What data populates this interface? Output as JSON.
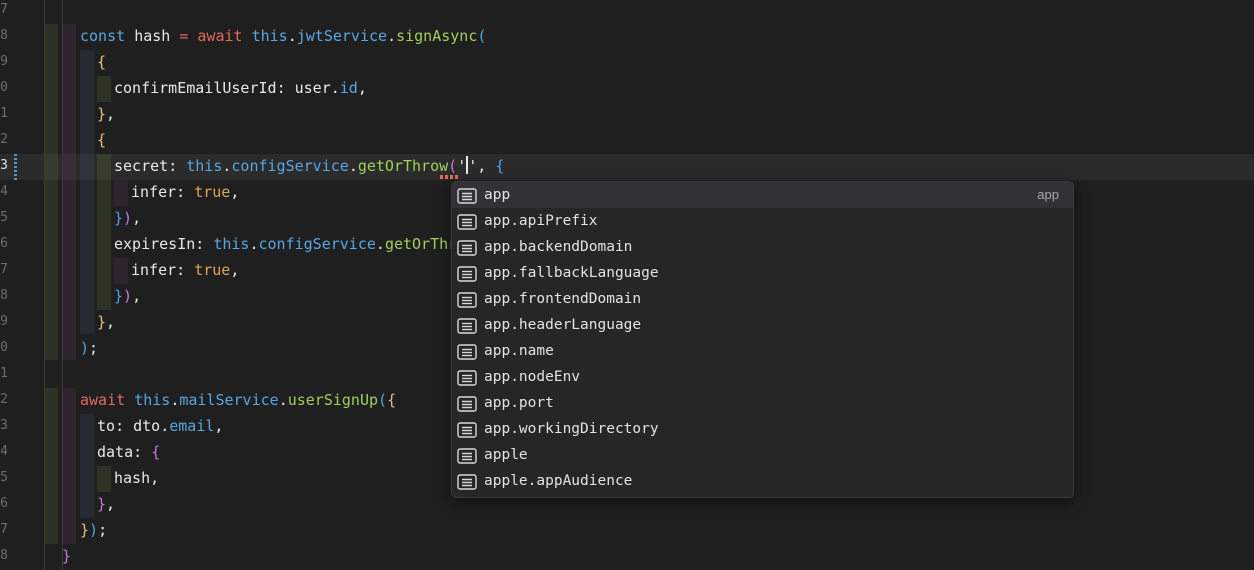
{
  "editor": {
    "gutter_numbers": [
      "7",
      "8",
      "9",
      "0",
      "1",
      "2",
      "3",
      "4",
      "5",
      "6",
      "7",
      "8",
      "9",
      "0",
      "1",
      "2",
      "3",
      "4",
      "5",
      "6",
      "7",
      "8"
    ],
    "active_line_number": "3",
    "lines": [
      {
        "tokens": []
      },
      {
        "tokens": [
          {
            "t": "const ",
            "c": "tk-kw"
          },
          {
            "t": "hash ",
            "c": "tk-var"
          },
          {
            "t": "= ",
            "c": "tk-op"
          },
          {
            "t": "await ",
            "c": "tk-kw2"
          },
          {
            "t": "this",
            "c": "tk-kw"
          },
          {
            "t": ".",
            "c": "tk-var"
          },
          {
            "t": "jwtService",
            "c": "tk-prop"
          },
          {
            "t": ".",
            "c": "tk-var"
          },
          {
            "t": "signAsync",
            "c": "tk-fn"
          },
          {
            "t": "(",
            "c": "br3"
          }
        ]
      },
      {
        "tokens": [
          {
            "t": "{",
            "c": "br1"
          }
        ]
      },
      {
        "tokens": [
          {
            "t": "confirmEmailUserId",
            "c": "tk-key"
          },
          {
            "t": ": ",
            "c": "tk-var"
          },
          {
            "t": "user",
            "c": "tk-var"
          },
          {
            "t": ".",
            "c": "tk-var"
          },
          {
            "t": "id",
            "c": "tk-prop"
          },
          {
            "t": ",",
            "c": "tk-var"
          }
        ]
      },
      {
        "tokens": [
          {
            "t": "}",
            "c": "br1"
          },
          {
            "t": ",",
            "c": "tk-var"
          }
        ]
      },
      {
        "tokens": [
          {
            "t": "{",
            "c": "br1"
          }
        ]
      },
      {
        "tokens": [
          {
            "t": "secret",
            "c": "tk-key"
          },
          {
            "t": ": ",
            "c": "tk-var"
          },
          {
            "t": "this",
            "c": "tk-kw"
          },
          {
            "t": ".",
            "c": "tk-var"
          },
          {
            "t": "configService",
            "c": "tk-prop"
          },
          {
            "t": ".",
            "c": "tk-var"
          },
          {
            "t": "getOrThrow",
            "c": "tk-fn"
          },
          {
            "t": "(",
            "c": "br2"
          },
          {
            "t": "'",
            "c": "tk-str"
          },
          {
            "t": "|CURSOR|",
            "c": "cursor"
          },
          {
            "t": "'",
            "c": "tk-str"
          },
          {
            "t": ", ",
            "c": "tk-var"
          },
          {
            "t": "{",
            "c": "br3"
          }
        ]
      },
      {
        "tokens": [
          {
            "t": "infer",
            "c": "tk-key"
          },
          {
            "t": ": ",
            "c": "tk-var"
          },
          {
            "t": "true",
            "c": "tk-bool"
          },
          {
            "t": ",",
            "c": "tk-var"
          }
        ]
      },
      {
        "tokens": [
          {
            "t": "}",
            "c": "br3"
          },
          {
            "t": ")",
            "c": "br2"
          },
          {
            "t": ",",
            "c": "tk-var"
          }
        ]
      },
      {
        "tokens": [
          {
            "t": "expiresIn",
            "c": "tk-key"
          },
          {
            "t": ": ",
            "c": "tk-var"
          },
          {
            "t": "this",
            "c": "tk-kw"
          },
          {
            "t": ".",
            "c": "tk-var"
          },
          {
            "t": "configService",
            "c": "tk-prop"
          },
          {
            "t": ".",
            "c": "tk-var"
          },
          {
            "t": "getOrThro",
            "c": "tk-fn"
          }
        ]
      },
      {
        "tokens": [
          {
            "t": "infer",
            "c": "tk-key"
          },
          {
            "t": ": ",
            "c": "tk-var"
          },
          {
            "t": "true",
            "c": "tk-bool"
          },
          {
            "t": ",",
            "c": "tk-var"
          }
        ]
      },
      {
        "tokens": [
          {
            "t": "}",
            "c": "br3"
          },
          {
            "t": ")",
            "c": "br2"
          },
          {
            "t": ",",
            "c": "tk-var"
          }
        ]
      },
      {
        "tokens": [
          {
            "t": "}",
            "c": "br1"
          },
          {
            "t": ",",
            "c": "tk-var"
          }
        ]
      },
      {
        "tokens": [
          {
            "t": ")",
            "c": "br3"
          },
          {
            "t": ";",
            "c": "tk-var"
          }
        ]
      },
      {
        "tokens": []
      },
      {
        "tokens": [
          {
            "t": "await ",
            "c": "tk-kw2"
          },
          {
            "t": "this",
            "c": "tk-kw"
          },
          {
            "t": ".",
            "c": "tk-var"
          },
          {
            "t": "mailService",
            "c": "tk-prop"
          },
          {
            "t": ".",
            "c": "tk-var"
          },
          {
            "t": "userSignUp",
            "c": "tk-fn"
          },
          {
            "t": "(",
            "c": "br3"
          },
          {
            "t": "{",
            "c": "br1"
          }
        ]
      },
      {
        "tokens": [
          {
            "t": "to",
            "c": "tk-key"
          },
          {
            "t": ": ",
            "c": "tk-var"
          },
          {
            "t": "dto",
            "c": "tk-var"
          },
          {
            "t": ".",
            "c": "tk-var"
          },
          {
            "t": "email",
            "c": "tk-prop"
          },
          {
            "t": ",",
            "c": "tk-var"
          }
        ]
      },
      {
        "tokens": [
          {
            "t": "data",
            "c": "tk-key"
          },
          {
            "t": ": ",
            "c": "tk-var"
          },
          {
            "t": "{",
            "c": "br2"
          }
        ]
      },
      {
        "tokens": [
          {
            "t": "hash",
            "c": "tk-var"
          },
          {
            "t": ",",
            "c": "tk-var"
          }
        ]
      },
      {
        "tokens": [
          {
            "t": "}",
            "c": "br2"
          },
          {
            "t": ",",
            "c": "tk-var"
          }
        ]
      },
      {
        "tokens": [
          {
            "t": "}",
            "c": "br1"
          },
          {
            "t": ")",
            "c": "br3"
          },
          {
            "t": ";",
            "c": "tk-var"
          }
        ]
      },
      {
        "tokens": [
          {
            "t": "}",
            "c": "br2"
          }
        ]
      }
    ]
  },
  "suggest": {
    "items": [
      {
        "label": "app",
        "detail": "app",
        "icon": "property-icon",
        "selected": true
      },
      {
        "label": "app.apiPrefix",
        "detail": "",
        "icon": "property-icon"
      },
      {
        "label": "app.backendDomain",
        "detail": "",
        "icon": "property-icon"
      },
      {
        "label": "app.fallbackLanguage",
        "detail": "",
        "icon": "property-icon"
      },
      {
        "label": "app.frontendDomain",
        "detail": "",
        "icon": "property-icon"
      },
      {
        "label": "app.headerLanguage",
        "detail": "",
        "icon": "property-icon"
      },
      {
        "label": "app.name",
        "detail": "",
        "icon": "property-icon"
      },
      {
        "label": "app.nodeEnv",
        "detail": "",
        "icon": "property-icon"
      },
      {
        "label": "app.port",
        "detail": "",
        "icon": "property-icon"
      },
      {
        "label": "app.workingDirectory",
        "detail": "",
        "icon": "property-icon"
      },
      {
        "label": "apple",
        "detail": "",
        "icon": "property-icon"
      },
      {
        "label": "apple.appAudience",
        "detail": "",
        "icon": "property-icon"
      }
    ]
  }
}
